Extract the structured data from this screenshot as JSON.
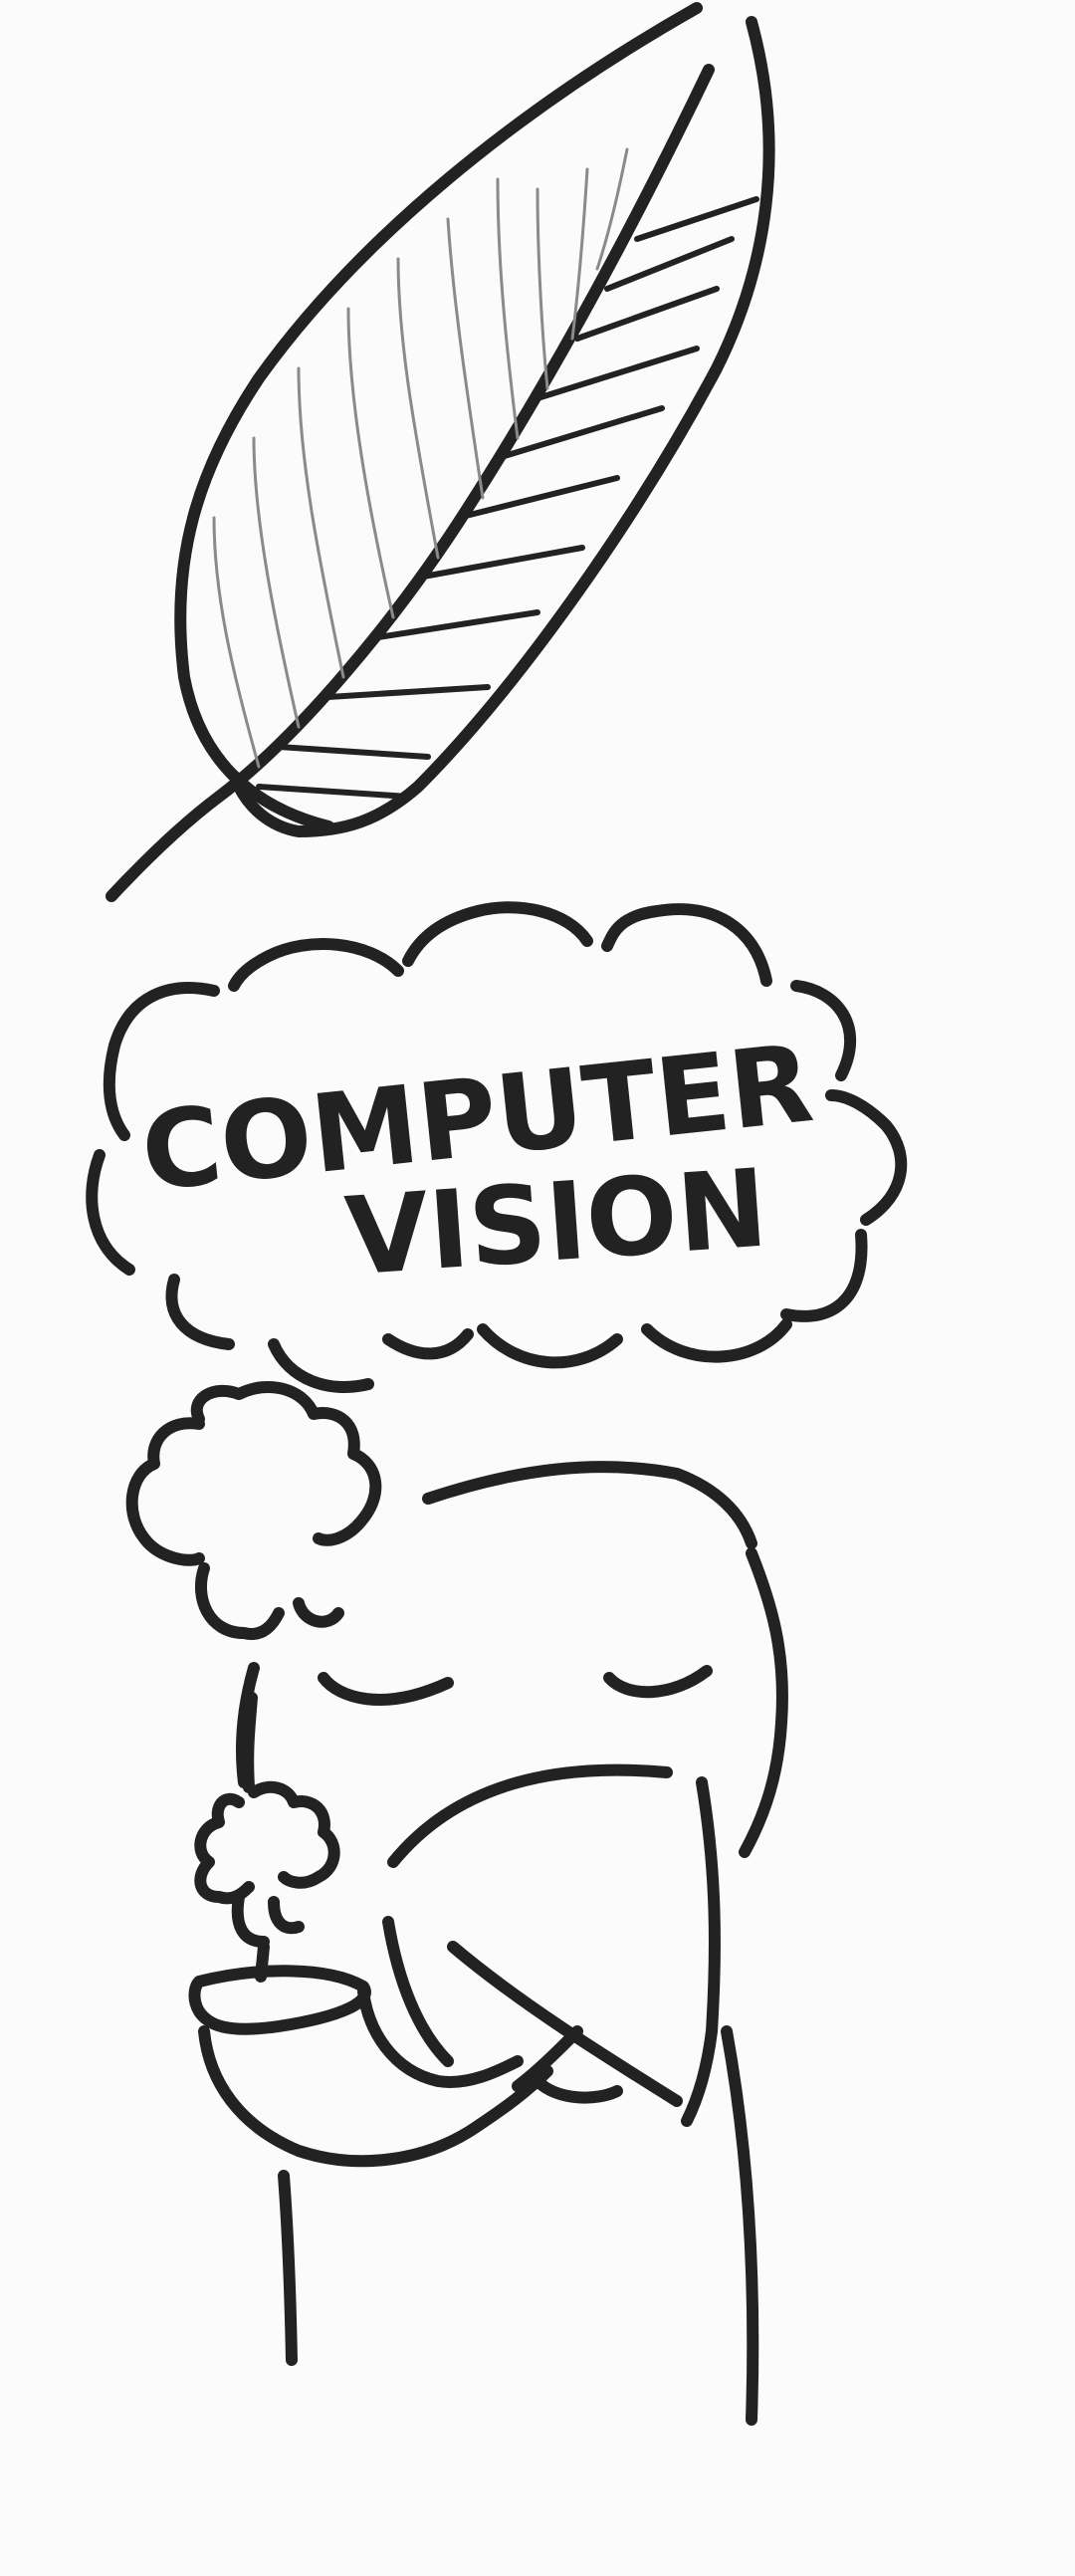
{
  "drawing": {
    "speech_text": {
      "line1": "COMPUTER",
      "line2": "VISION"
    },
    "ink_color": "#222222",
    "background_color": "#fbfbfb",
    "elements": [
      "leaf",
      "thought-cloud",
      "steam-puffs",
      "person-with-cup"
    ]
  }
}
